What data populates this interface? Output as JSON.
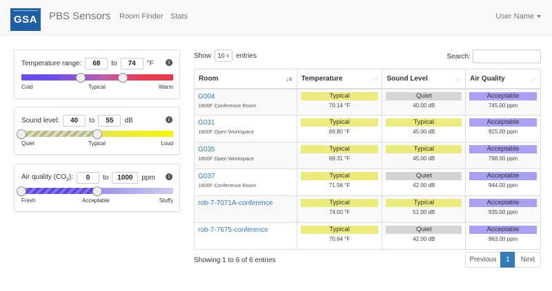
{
  "navbar": {
    "logo_text": "GSA",
    "brand": "PBS Sensors",
    "links": [
      "Room Finder",
      "Stats"
    ],
    "user": "User Name"
  },
  "filters": {
    "temperature": {
      "label": "Temperature range:",
      "min": "68",
      "to": "to",
      "max": "74",
      "unit": "°F",
      "scale": [
        "Cold",
        "Typical",
        "Warm"
      ],
      "handles": [
        0.39,
        0.67
      ]
    },
    "sound": {
      "label": "Sound level:",
      "min": "40",
      "to": "to",
      "max": "55",
      "unit": "dB",
      "scale": [
        "Quiet",
        "Typical",
        "Loud"
      ],
      "handles": [
        0.0,
        0.5
      ]
    },
    "air": {
      "label_pre": "Air quality (CO",
      "label_sub": "2",
      "label_post": "):",
      "min": "0",
      "to": "to",
      "max": "1000",
      "unit": "ppm",
      "scale": [
        "Fresh",
        "Acceptable",
        "Stuffy"
      ],
      "handles": [
        0.0,
        0.5
      ]
    }
  },
  "table_controls": {
    "show": "Show",
    "length": "10",
    "entries": "entries",
    "search_label": "Search:"
  },
  "table": {
    "headers": [
      "Room",
      "Temperature",
      "Sound Level",
      "Air Quality"
    ],
    "rows": [
      {
        "room": "G004",
        "sub": "1800F Conference Room",
        "temp": "Typical",
        "temp_val": "70.14 °F",
        "sound": "Quiet",
        "sound_val": "40.00 dB",
        "air": "Acceptable",
        "air_val": "745.00 ppm"
      },
      {
        "room": "G031",
        "sub": "1800F Open Workspace",
        "temp": "Typical",
        "temp_val": "69.80 °F",
        "sound": "Typical",
        "sound_val": "45.00 dB",
        "air": "Acceptable",
        "air_val": "915.00 ppm"
      },
      {
        "room": "G035",
        "sub": "1800F Open Workspace",
        "temp": "Typical",
        "temp_val": "69.31 °F",
        "sound": "Typical",
        "sound_val": "45.00 dB",
        "air": "Acceptable",
        "air_val": "798.00 ppm"
      },
      {
        "room": "G037",
        "sub": "1800F Conference Room",
        "temp": "Typical",
        "temp_val": "71.56 °F",
        "sound": "Quiet",
        "sound_val": "42.00 dB",
        "air": "Acceptable",
        "air_val": "944.00 ppm"
      },
      {
        "room": "rob-7-7071A-conference",
        "sub": "",
        "temp": "Typical",
        "temp_val": "74.00 °F",
        "sound": "Typical",
        "sound_val": "51.00 dB",
        "air": "Acceptable",
        "air_val": "935.00 ppm"
      },
      {
        "room": "rob-7-7675-conference",
        "sub": "",
        "temp": "Typical",
        "temp_val": "70.64 °F",
        "sound": "Quiet",
        "sound_val": "42.00 dB",
        "air": "Acceptable",
        "air_val": "963.00 ppm"
      }
    ]
  },
  "footer": {
    "info": "Showing 1 to 6 of 6 entries",
    "previous": "Previous",
    "page": "1",
    "next": "Next"
  },
  "colors": {
    "brand": "#1e5fa6",
    "link": "#337ab7",
    "typical": "#ecec7e",
    "quiet": "#d5d5d5",
    "acceptable": "#a8a0f2"
  }
}
